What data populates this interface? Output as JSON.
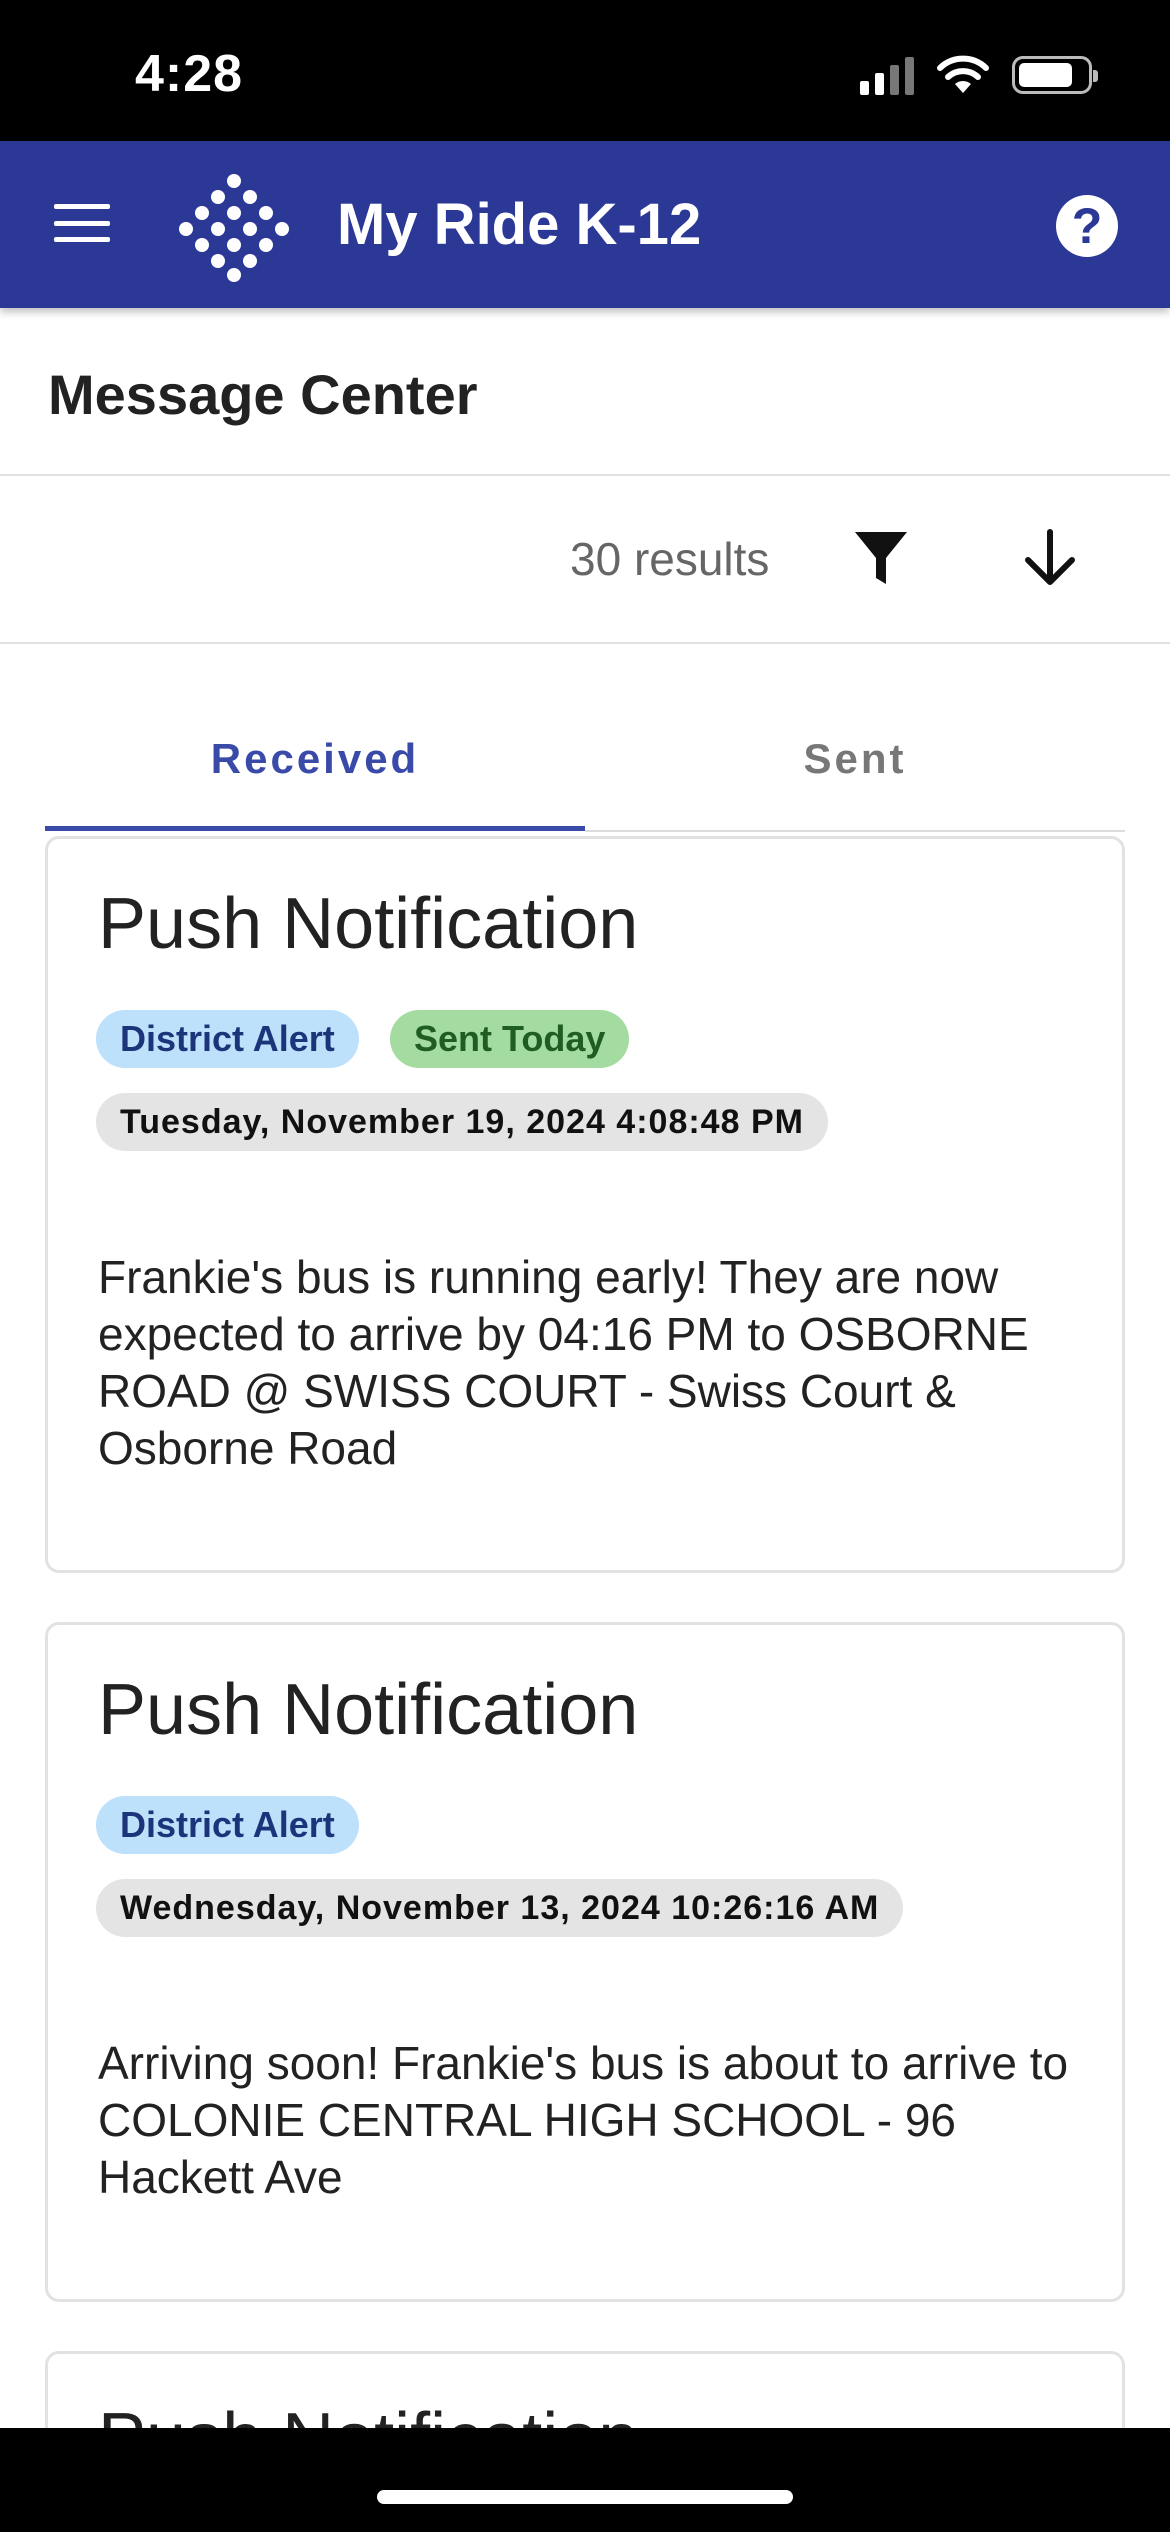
{
  "status_bar": {
    "time": "4:28"
  },
  "app_bar": {
    "title": "My Ride K-12",
    "help_glyph": "?",
    "colors": {
      "background": "#2b3896"
    }
  },
  "header": {
    "title": "Message Center"
  },
  "toolbar": {
    "results": "30 results"
  },
  "tabs": [
    {
      "label": "Received",
      "active": true
    },
    {
      "label": "Sent",
      "active": false
    }
  ],
  "messages": [
    {
      "title": "Push Notification",
      "badges": [
        "District Alert",
        "Sent Today"
      ],
      "date": "Tuesday, November 19, 2024 4:08:48 PM",
      "body": "Frankie's bus is running early! They are now expected to arrive by 04:16 PM to OSBORNE ROAD @ SWISS COURT - Swiss Court & Osborne Road"
    },
    {
      "title": "Push Notification",
      "badges": [
        "District Alert"
      ],
      "date": "Wednesday, November 13, 2024 10:26:16 AM",
      "body": "Arriving soon! Frankie's bus is about to arrive to COLONIE CENTRAL HIGH SCHOOL - 96 Hackett Ave"
    },
    {
      "title": "Push Notification"
    }
  ]
}
